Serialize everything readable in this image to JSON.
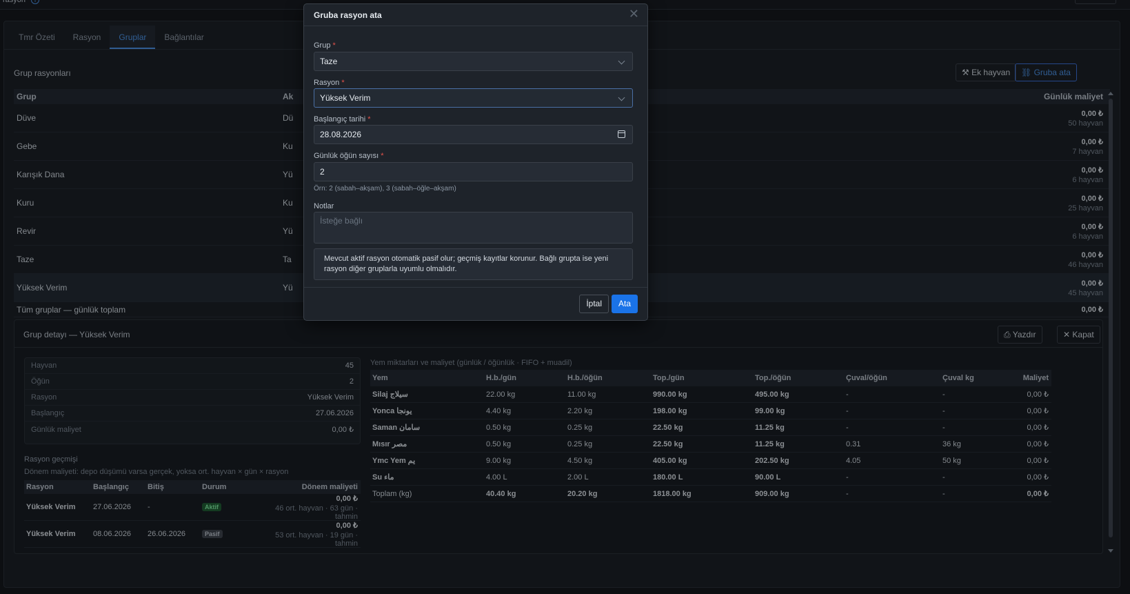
{
  "header": {
    "title": "rasyon",
    "help_icon": "info-icon"
  },
  "tabs": [
    "Tmr Özeti",
    "Rasyon",
    "Gruplar",
    "Bağlantılar"
  ],
  "group_rations": {
    "title": "Grup rasyonları",
    "extra_animal_btn": "Ek hayvan",
    "assign_btn": "Gruba ata",
    "columns": {
      "group": "Grup",
      "active": "Ak",
      "daily_cost": "Günlük maliyet"
    },
    "rows": [
      {
        "group": "Düve",
        "active": "Dü",
        "cost": "0,00 ₺",
        "animals": "50 hayvan"
      },
      {
        "group": "Gebe",
        "active": "Ku",
        "cost": "0,00 ₺",
        "animals": "7 hayvan"
      },
      {
        "group": "Karışık Dana",
        "active": "Yü",
        "cost": "0,00 ₺",
        "animals": "6 hayvan"
      },
      {
        "group": "Kuru",
        "active": "Ku",
        "cost": "0,00 ₺",
        "animals": "25 hayvan"
      },
      {
        "group": "Revir",
        "active": "Yü",
        "cost": "0,00 ₺",
        "animals": "6 hayvan"
      },
      {
        "group": "Taze",
        "active": "Ta",
        "cost": "0,00 ₺",
        "animals": "46 hayvan"
      },
      {
        "group": "Yüksek Verim",
        "active": "Yü",
        "cost": "0,00 ₺",
        "animals": "45 hayvan"
      }
    ],
    "total_label": "Tüm gruplar — günlük toplam",
    "total_cost": "0,00 ₺"
  },
  "detail": {
    "title": "Grup detayı — Yüksek Verim",
    "print_btn": "Yazdır",
    "close_btn": "Kapat",
    "info": [
      {
        "k": "Hayvan",
        "v": "45"
      },
      {
        "k": "Öğün",
        "v": "2"
      },
      {
        "k": "Rasyon",
        "v": "Yüksek Verim"
      },
      {
        "k": "Başlangıç",
        "v": "27.06.2026"
      },
      {
        "k": "Günlük maliyet",
        "v": "0,00 ₺"
      }
    ],
    "history_title": "Rasyon geçmişi",
    "history_note": "Dönem maliyeti: depo düşümü varsa gerçek, yoksa ort. hayvan × gün × rasyon",
    "history_cols": [
      "Rasyon",
      "Başlangıç",
      "Bitiş",
      "Durum",
      "Dönem maliyeti"
    ],
    "history": [
      {
        "ration": "Yüksek Verim",
        "start": "27.06.2026",
        "end": "-",
        "status": "Aktif",
        "cost": "0,00 ₺",
        "note": "46 ort. hayvan · 63 gün · tahmin"
      },
      {
        "ration": "Yüksek Verim",
        "start": "08.06.2026",
        "end": "26.06.2026",
        "status": "Pasif",
        "cost": "0,00 ₺",
        "note": "53 ort. hayvan · 19 gün · tahmin"
      }
    ],
    "feed_title": "Yem miktarları ve maliyet (günlük / öğünlük · FIFO + muadil)",
    "feed_cols": [
      "Yem",
      "H.b./gün",
      "H.b./öğün",
      "Top./gün",
      "Top./öğün",
      "Çuval/öğün",
      "Çuval kg",
      "Maliyet"
    ],
    "feeds": [
      {
        "name": "Silaj",
        "ar": "سيلاج",
        "hb_day": "22.00 kg",
        "hb_meal": "11.00 kg",
        "tot_day": "990.00 kg",
        "tot_meal": "495.00 kg",
        "bag_meal": "-",
        "bag_kg": "-",
        "cost": "0,00 ₺"
      },
      {
        "name": "Yonca",
        "ar": "يونجا",
        "hb_day": "4.40 kg",
        "hb_meal": "2.20 kg",
        "tot_day": "198.00 kg",
        "tot_meal": "99.00 kg",
        "bag_meal": "-",
        "bag_kg": "-",
        "cost": "0,00 ₺"
      },
      {
        "name": "Saman",
        "ar": "سامان",
        "hb_day": "0.50 kg",
        "hb_meal": "0.25 kg",
        "tot_day": "22.50 kg",
        "tot_meal": "11.25 kg",
        "bag_meal": "-",
        "bag_kg": "-",
        "cost": "0,00 ₺"
      },
      {
        "name": "Mısır",
        "ar": "مصر",
        "hb_day": "0.50 kg",
        "hb_meal": "0.25 kg",
        "tot_day": "22.50 kg",
        "tot_meal": "11.25 kg",
        "bag_meal": "0.31",
        "bag_kg": "36 kg",
        "cost": "0,00 ₺"
      },
      {
        "name": "Ymc Yem",
        "ar": "يم",
        "hb_day": "9.00 kg",
        "hb_meal": "4.50 kg",
        "tot_day": "405.00 kg",
        "tot_meal": "202.50 kg",
        "bag_meal": "4.05",
        "bag_kg": "50 kg",
        "cost": "0,00 ₺"
      },
      {
        "name": "Su",
        "ar": "ماء",
        "hb_day": "4.00 L",
        "hb_meal": "2.00 L",
        "tot_day": "180.00 L",
        "tot_meal": "90.00 L",
        "bag_meal": "-",
        "bag_kg": "-",
        "cost": "0,00 ₺"
      }
    ],
    "feed_total": {
      "name": "Toplam (kg)",
      "hb_day": "40.40 kg",
      "hb_meal": "20.20 kg",
      "tot_day": "1818.00 kg",
      "tot_meal": "909.00 kg",
      "bag_meal": "-",
      "bag_kg": "-",
      "cost": "0,00 ₺"
    }
  },
  "modal": {
    "title": "Gruba rasyon ata",
    "group_label": "Grup",
    "group_value": "Taze",
    "ration_label": "Rasyon",
    "ration_value": "Yüksek Verim",
    "start_label": "Başlangıç tarihi",
    "start_value": "28.08.2026",
    "meals_label": "Günlük öğün sayısı",
    "meals_value": "2",
    "meals_hint": "Örn: 2 (sabah–akşam), 3 (sabah–öğle–akşam)",
    "notes_label": "Notlar",
    "notes_placeholder": "İsteğe bağlı",
    "alert": "Mevcut aktif rasyon otomatik pasif olur; geçmiş kayıtlar korunur. Bağlı grupta ise yeni rasyon diğer gruplarla uyumlu olmalıdır.",
    "cancel": "İptal",
    "submit": "Ata",
    "required_mark": "*"
  }
}
